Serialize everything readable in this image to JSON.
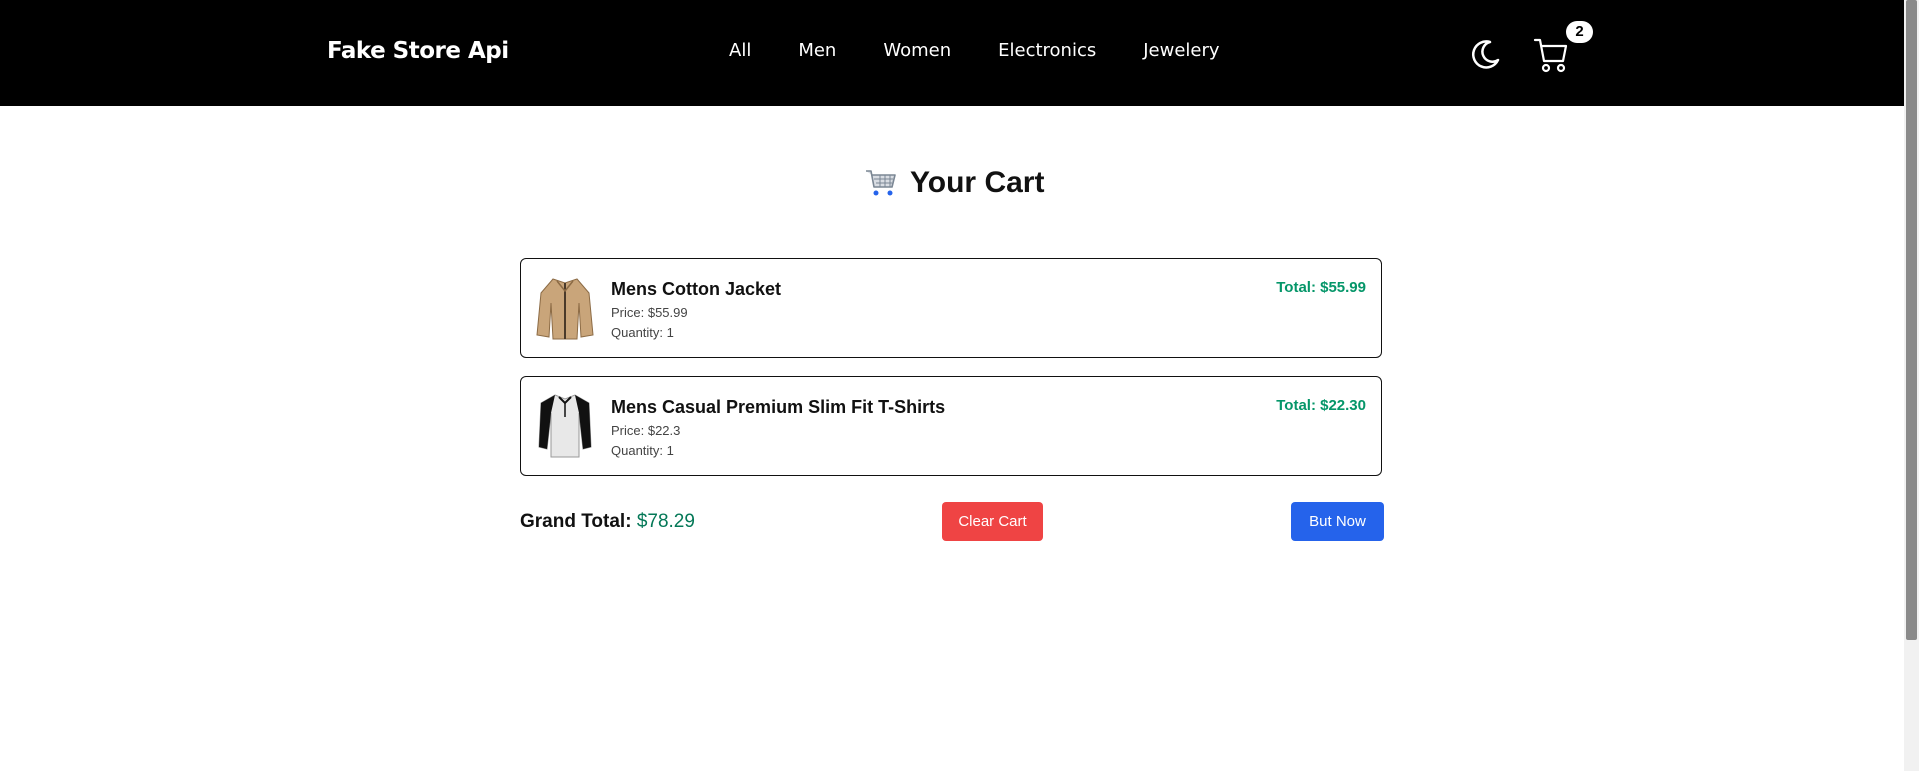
{
  "navbar": {
    "brand": "Fake Store Api",
    "links": [
      "All",
      "Men",
      "Women",
      "Electronics",
      "Jewelery"
    ],
    "cart_count": "2",
    "icons": [
      "moon-icon",
      "cart-icon"
    ]
  },
  "cart": {
    "title": "Your Cart",
    "items": [
      {
        "name": "Mens Cotton Jacket",
        "price": "Price: $55.99",
        "quantity": "Quantity: 1",
        "total": "Total: $55.99",
        "image": "jacket"
      },
      {
        "name": "Mens Casual Premium Slim Fit T-Shirts",
        "price": "Price: $22.3",
        "quantity": "Quantity: 1",
        "total": "Total: $22.30",
        "image": "t-shirt"
      }
    ],
    "grand_total_label": "Grand Total:",
    "grand_total_value": "$78.29",
    "clear_label": "Clear Cart",
    "buy_label": "But Now"
  },
  "colors": {
    "navbar_bg": "#000000",
    "total_green": "#059669",
    "clear_red": "#ef4444",
    "buy_blue": "#2563eb"
  }
}
